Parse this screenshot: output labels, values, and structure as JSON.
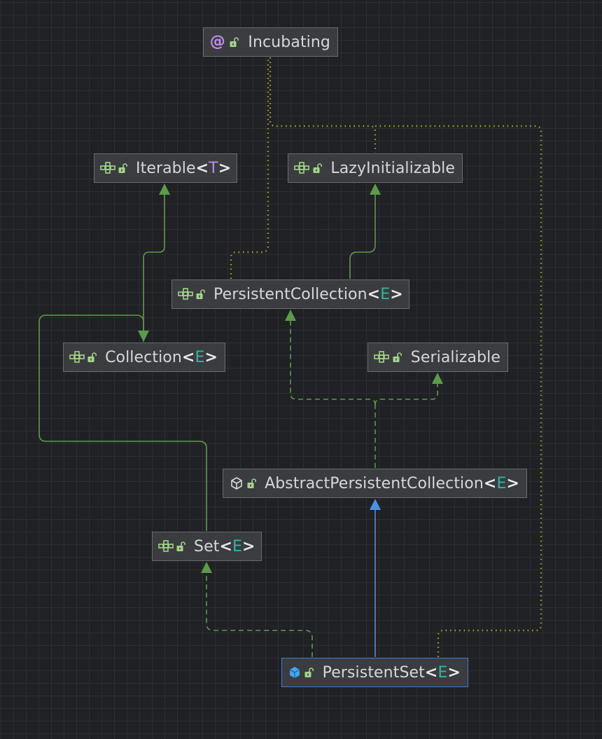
{
  "diagram": {
    "nodes": [
      {
        "id": "incubating",
        "kind": "annotation",
        "name": "Incubating",
        "type_param": ""
      },
      {
        "id": "iterable",
        "kind": "interface",
        "name": "Iterable",
        "type_param": "T"
      },
      {
        "id": "lazy",
        "kind": "interface",
        "name": "LazyInitializable",
        "type_param": ""
      },
      {
        "id": "persistentcollection",
        "kind": "interface",
        "name": "PersistentCollection",
        "type_param": "E"
      },
      {
        "id": "collection",
        "kind": "interface",
        "name": "Collection",
        "type_param": "E"
      },
      {
        "id": "serializable",
        "kind": "interface",
        "name": "Serializable",
        "type_param": ""
      },
      {
        "id": "abstractpc",
        "kind": "abstract-class",
        "name": "AbstractPersistentCollection",
        "type_param": "E"
      },
      {
        "id": "set",
        "kind": "interface",
        "name": "Set",
        "type_param": "E"
      },
      {
        "id": "persistentset",
        "kind": "class",
        "name": "PersistentSet",
        "type_param": "E",
        "selected": true
      }
    ],
    "edges": [
      {
        "from": "collection",
        "to": "iterable",
        "relation": "extends"
      },
      {
        "from": "persistentcollection",
        "to": "lazy",
        "relation": "extends"
      },
      {
        "from": "persistentcollection",
        "to": "incubating",
        "relation": "annotated-by"
      },
      {
        "from": "abstractpc",
        "to": "persistentcollection",
        "relation": "implements"
      },
      {
        "from": "abstractpc",
        "to": "serializable",
        "relation": "implements"
      },
      {
        "from": "set",
        "to": "collection",
        "relation": "extends"
      },
      {
        "from": "persistentset",
        "to": "abstractpc",
        "relation": "extends-class"
      },
      {
        "from": "persistentset",
        "to": "set",
        "relation": "implements"
      },
      {
        "from": "persistentset",
        "to": "incubating",
        "relation": "annotated-by"
      },
      {
        "from": "lazy",
        "to": "incubating",
        "relation": "annotated-by"
      }
    ]
  },
  "colors": {
    "background": "#202124",
    "extends_line": "#5c9a4c",
    "implements_line": "#5c9a4c",
    "class_extends_line": "#4a8fe8",
    "annotation_line": "#a8a628",
    "type_param": "#2cb7a3",
    "type_var": "#b48ce8",
    "interface_icon": "#a3d48a",
    "lock_icon": "#a3d48a",
    "class_icon": "#3fa7ee",
    "annotation_icon": "#c48ef0"
  },
  "icons": {
    "interface": "interface-icon",
    "annotation": "annotation-icon",
    "abstract-class": "abstract-class-icon",
    "class": "class-icon",
    "lock": "unlocked-padlock-icon"
  }
}
